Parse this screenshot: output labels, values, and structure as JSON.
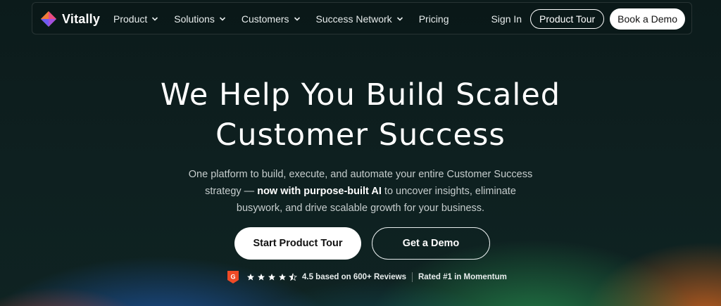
{
  "brand": {
    "name": "Vitally"
  },
  "nav": {
    "items": [
      {
        "label": "Product",
        "has_dropdown": true
      },
      {
        "label": "Solutions",
        "has_dropdown": true
      },
      {
        "label": "Customers",
        "has_dropdown": true
      },
      {
        "label": "Success Network",
        "has_dropdown": true
      },
      {
        "label": "Pricing",
        "has_dropdown": false
      }
    ],
    "sign_in": "Sign In",
    "product_tour": "Product Tour",
    "book_demo": "Book a Demo"
  },
  "hero": {
    "headline_line1": "We Help You Build Scaled",
    "headline_line2": "Customer Success",
    "subtitle_part1": "One platform to build, execute, and automate your entire Customer Success strategy — ",
    "subtitle_bold": "now with purpose-built AI",
    "subtitle_part2": " to uncover insights, eliminate busywork, and drive scalable growth for your business.",
    "cta_primary": "Start Product Tour",
    "cta_secondary": "Get a Demo"
  },
  "rating": {
    "badge_icon": "g2-icon",
    "stars": 4.5,
    "reviews_text": "4.5 based on 600+ Reviews",
    "momentum_text": "Rated #1 in Momentum"
  },
  "colors": {
    "background": "#0d1d1d",
    "button_light": "#ffffff",
    "g2_badge": "#ef4a26",
    "text_muted": "#c6cdcd"
  }
}
